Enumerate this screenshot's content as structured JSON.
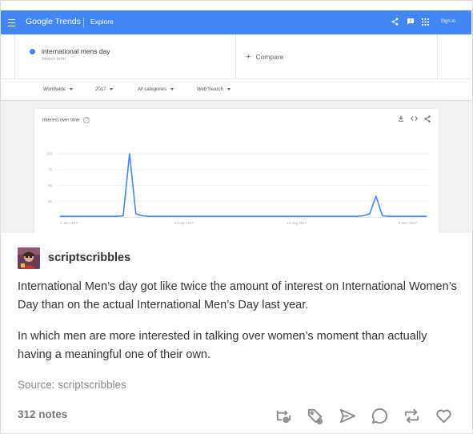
{
  "trends": {
    "header": {
      "logo": "Google Trends",
      "explore": "Explore",
      "signin": "Sign in",
      "color": "#4285f4"
    },
    "search": {
      "term": "international mens day",
      "term_type": "Search term",
      "compare": "Compare"
    },
    "filters": {
      "region": "Worldwide",
      "period": "2017",
      "category": "All categories",
      "property": "Web Search"
    },
    "card_title": "Interest over time",
    "chart_data": {
      "type": "line",
      "title": "Interest over time",
      "xlabel": "",
      "ylabel": "",
      "ylim": [
        0,
        100
      ],
      "y_ticks": [
        "100",
        "75",
        "50",
        "25"
      ],
      "x_ticks": [
        "1 Jan 2017",
        "23 Apr 2017",
        "13 Aug 2017",
        "3 Dec 2017"
      ],
      "grid": true,
      "series": [
        {
          "color": "#4285f4",
          "values": [
            1,
            1,
            1,
            1,
            1,
            1,
            1,
            1,
            1,
            1,
            2,
            100,
            5,
            2,
            1,
            1,
            1,
            1,
            1,
            1,
            1,
            1,
            1,
            1,
            1,
            1,
            1,
            1,
            1,
            1,
            1,
            1,
            1,
            1,
            1,
            1,
            1,
            1,
            1,
            1,
            1,
            1,
            1,
            1,
            1,
            1,
            1,
            1,
            2,
            5,
            33,
            2,
            1,
            1,
            1,
            1,
            1,
            1,
            1
          ]
        }
      ]
    }
  },
  "post": {
    "username": "scriptscribbles",
    "paragraph_1": "International Men’s day got like twice the amount of interest on International Women’s Day than on the actual International Men’s Day last year.",
    "paragraph_2": "In which men are more interested in talking over women’s moment than actually having a meaningful one of their own.",
    "source": "Source: scriptscribbles",
    "notes": "312 notes",
    "actions": [
      "watch-reblog-icon",
      "tag-icon",
      "share-icon",
      "reply-icon",
      "reblog-icon",
      "like-icon"
    ]
  }
}
